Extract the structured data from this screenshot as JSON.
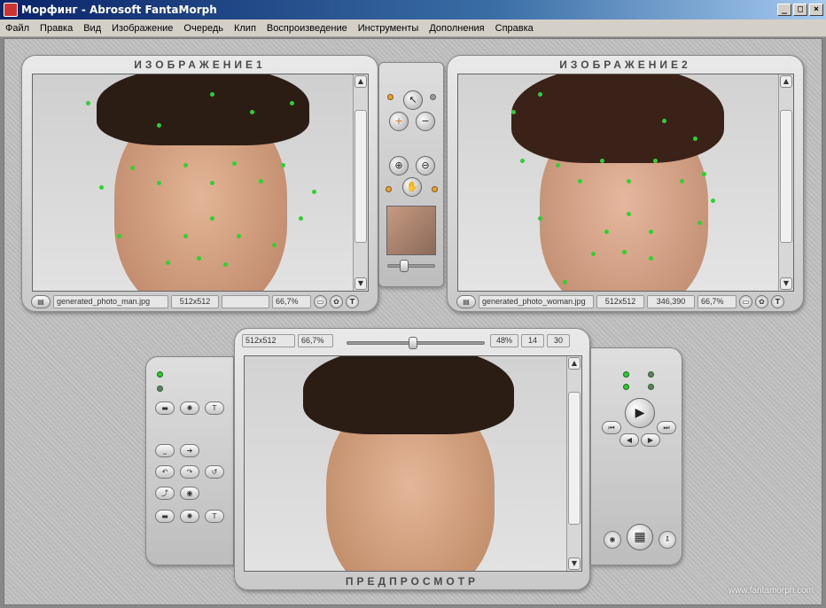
{
  "window": {
    "title": "Морфинг - Abrosoft FantaMorph",
    "buttons": {
      "minimize": "_",
      "maximize": "□",
      "close": "×"
    }
  },
  "menu": [
    "Файл",
    "Правка",
    "Вид",
    "Изображение",
    "Очередь",
    "Клип",
    "Воспроизведение",
    "Инструменты",
    "Дополнения",
    "Справка"
  ],
  "image1": {
    "title": "ИЗОБРАЖЕНИЕ1",
    "filename": "generated_photo_man.jpg",
    "size": "512x512",
    "coords": "",
    "zoom": "66,7%"
  },
  "image2": {
    "title": "ИЗОБРАЖЕНИЕ2",
    "filename": "generated_photo_woman.jpg",
    "size": "512x512",
    "coords": "346,390",
    "zoom": "66,7%"
  },
  "preview": {
    "title": "ПРЕДПРОСМОТР",
    "size": "512x512",
    "zoom": "66,7%",
    "percent": "48%",
    "frame": "14",
    "total_frames": "30",
    "morph_fraction": 0.48
  },
  "footer": {
    "website": "www.fantamorph.com"
  },
  "icons": {
    "pointer": "↖",
    "add": "+",
    "remove": "−",
    "zoom_in": "⊕",
    "zoom_out": "⊖",
    "hand": "✋",
    "play": "▶",
    "first": "⏮",
    "last": "⏭",
    "prev": "◀",
    "next": "▶",
    "camera": "◉",
    "film": "▦",
    "export": "⇩"
  }
}
